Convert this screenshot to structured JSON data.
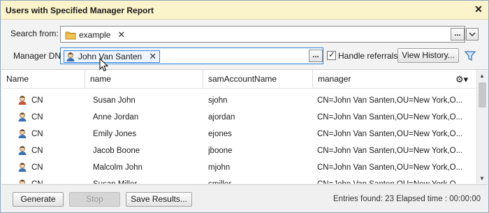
{
  "window": {
    "title": "Users with Specified Manager Report"
  },
  "search": {
    "label": "Search from:",
    "chip": "example",
    "browse": "...",
    "dropdown": "v"
  },
  "manager": {
    "label": "Manager DN",
    "chip": "John Van Santen",
    "browse": "...",
    "referrals": "Handle referrals",
    "view_history": "View History..."
  },
  "table": {
    "headers": [
      "Name",
      "name",
      "samAccountName",
      "manager"
    ],
    "rows": [
      {
        "type": "CN",
        "name": "Susan John",
        "sam": "sjohn",
        "manager": "CN=John Van Santen,OU=New York,O..."
      },
      {
        "type": "CN",
        "name": "Anne Jordan",
        "sam": "ajordan",
        "manager": "CN=John Van Santen,OU=New York,O..."
      },
      {
        "type": "CN",
        "name": "Emily Jones",
        "sam": "ejones",
        "manager": "CN=John Van Santen,OU=New York,O..."
      },
      {
        "type": "CN",
        "name": "Jacob Boone",
        "sam": "jboone",
        "manager": "CN=John Van Santen,OU=New York,O..."
      },
      {
        "type": "CN",
        "name": "Malcolm John",
        "sam": "mjohn",
        "manager": "CN=John Van Santen,OU=New York,O..."
      },
      {
        "type": "CN",
        "name": "Susan Miller",
        "sam": "smiller",
        "manager": "CN=John Van Santen,OU=New York,O..."
      }
    ]
  },
  "footer": {
    "generate": "Generate",
    "stop": "Stop",
    "save": "Save Results...",
    "status": "Entries found: 23  Elapsed time : 00:00:00"
  },
  "colors": {
    "title_bg": "#fbf3c9",
    "accent": "#2f7fd6"
  }
}
